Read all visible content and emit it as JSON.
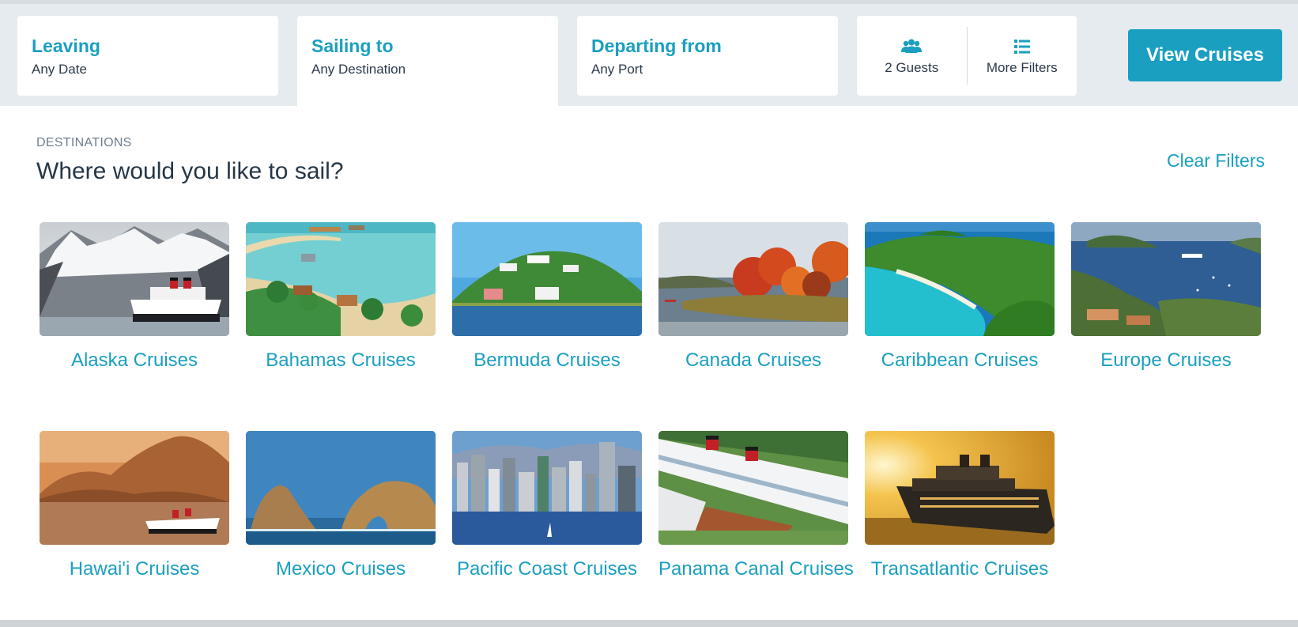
{
  "filters": {
    "leaving": {
      "title": "Leaving",
      "value": "Any Date"
    },
    "sailing_to": {
      "title": "Sailing to",
      "value": "Any Destination"
    },
    "departing_from": {
      "title": "Departing from",
      "value": "Any Port"
    },
    "guests": {
      "label": "2 Guests",
      "icon": "guests-icon"
    },
    "more_filters": {
      "label": "More Filters",
      "icon": "list-icon"
    }
  },
  "view_button": "View Cruises",
  "section": {
    "kicker": "DESTINATIONS",
    "title": "Where would you like to sail?",
    "clear_filters": "Clear Filters"
  },
  "destinations": [
    {
      "label": "Alaska Cruises"
    },
    {
      "label": "Bahamas Cruises"
    },
    {
      "label": "Bermuda Cruises"
    },
    {
      "label": "Canada Cruises"
    },
    {
      "label": "Caribbean Cruises"
    },
    {
      "label": "Europe Cruises"
    },
    {
      "label": "Hawai'i Cruises"
    },
    {
      "label": "Mexico Cruises"
    },
    {
      "label": "Pacific Coast Cruises"
    },
    {
      "label": "Panama Canal Cruises"
    },
    {
      "label": "Transatlantic Cruises"
    }
  ],
  "colors": {
    "accent": "#1a9fc0",
    "text_dark": "#253746",
    "topbar_bg": "#e6ebef"
  }
}
